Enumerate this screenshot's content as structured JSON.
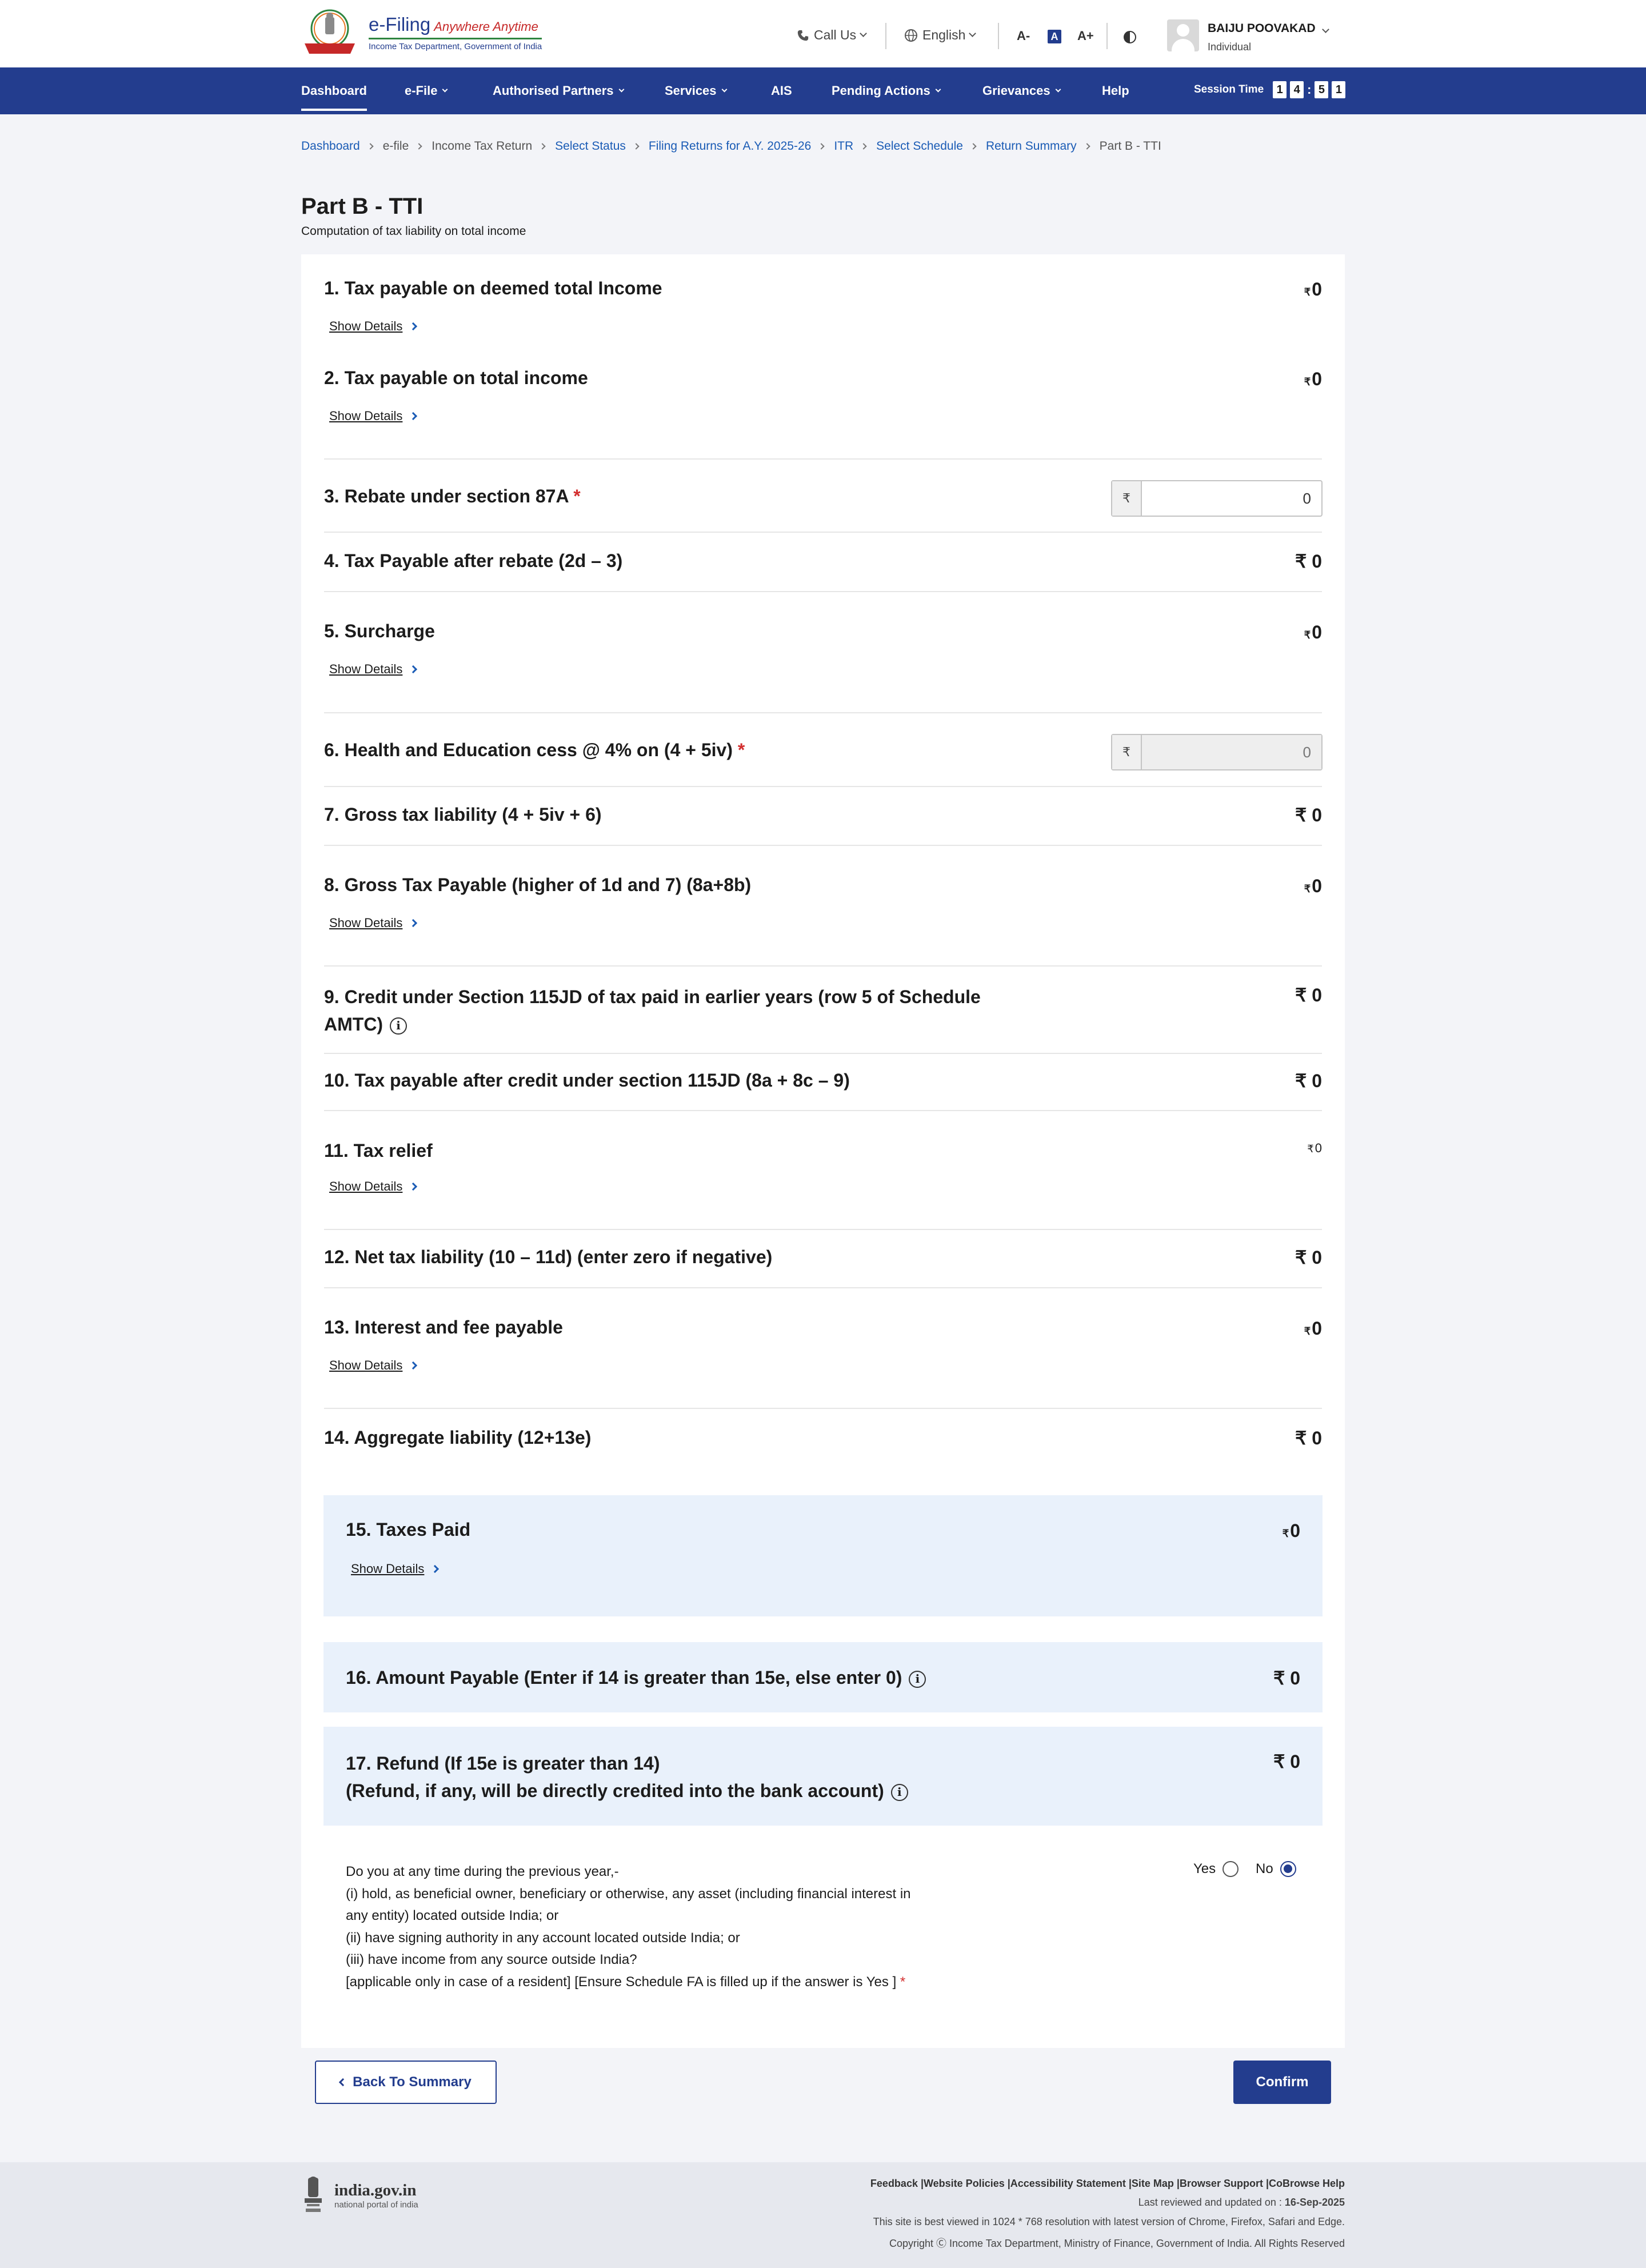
{
  "header": {
    "logo_title": "e-Filing",
    "logo_tagline": "Anywhere Anytime",
    "logo_subtitle": "Income Tax Department, Government of India",
    "call_us": "Call Us",
    "language": "English",
    "font_decrease": "A-",
    "font_normal": "A",
    "font_increase": "A+",
    "user_name": "BAIJU POOVAKAD",
    "user_role": "Individual"
  },
  "nav": {
    "items": [
      "Dashboard",
      "e-File",
      "Authorised Partners",
      "Services",
      "AIS",
      "Pending Actions",
      "Grievances",
      "Help"
    ],
    "session_label": "Session Time",
    "session_digits": [
      "1",
      "4",
      "5",
      "1"
    ]
  },
  "breadcrumb": [
    "Dashboard",
    "e-file",
    "Income Tax Return",
    "Select Status",
    "Filing Returns for A.Y. 2025-26",
    "ITR",
    "Select Schedule",
    "Return Summary",
    "Part B - TTI"
  ],
  "page": {
    "title": "Part B - TTI",
    "subtitle": "Computation of tax liability on total income"
  },
  "currency_symbol": "₹",
  "show_details_label": "Show Details",
  "rows": {
    "r1": {
      "label": "1. Tax payable on deemed total Income",
      "amount": "0"
    },
    "r2": {
      "label": "2. Tax payable on total income",
      "amount": "0"
    },
    "r3": {
      "label": "3. Rebate under section 87A",
      "required": "*",
      "value": "0"
    },
    "r4": {
      "label": "4. Tax Payable after rebate (2d – 3)",
      "amount": "0"
    },
    "r5": {
      "label": "5. Surcharge",
      "amount": "0"
    },
    "r6": {
      "label": "6. Health and Education cess @ 4% on (4 + 5iv)",
      "required": "*",
      "value": "0"
    },
    "r7": {
      "label": "7. Gross tax liability (4 + 5iv + 6)",
      "amount": "0"
    },
    "r8": {
      "label": "8. Gross Tax Payable (higher of 1d and 7) (8a+8b)",
      "amount": "0"
    },
    "r9": {
      "label_line1": "9. Credit under Section 115JD of tax paid in earlier years (row 5 of Schedule",
      "label_line2": "AMTC)",
      "amount": "0"
    },
    "r10": {
      "label": "10. Tax payable after credit under section 115JD (8a + 8c – 9)",
      "amount": "0"
    },
    "r11": {
      "label": "11. Tax relief",
      "amount": "0"
    },
    "r12": {
      "label": "12. Net tax liability (10 – 11d) (enter zero if negative)",
      "amount": "0"
    },
    "r13": {
      "label": "13. Interest and fee payable",
      "amount": "0"
    },
    "r14": {
      "label": "14. Aggregate liability (12+13e)",
      "amount": "0"
    },
    "r15": {
      "label": "15. Taxes Paid",
      "amount": "0"
    },
    "r16": {
      "label": "16. Amount Payable (Enter if 14 is greater than 15e, else enter 0)",
      "amount": "0"
    },
    "r17": {
      "label_line1": "17. Refund (If 15e is greater than 14)",
      "label_line2": "(Refund, if any, will be directly credited into the bank account)",
      "amount": "0"
    }
  },
  "foreign_asset_question": {
    "lines": [
      "Do you at any time during the previous year,-",
      "(i) hold, as beneficial owner, beneficiary or otherwise, any asset (including financial interest in",
      "any entity) located outside India; or",
      "(ii) have signing authority in any account located outside India; or",
      "(iii) have income from any source outside India?",
      "[applicable only in case of a resident] [Ensure Schedule FA is filled up if the answer is Yes ]"
    ],
    "required": "*",
    "yes_label": "Yes",
    "no_label": "No",
    "selected": "No"
  },
  "buttons": {
    "back": "Back To Summary",
    "confirm": "Confirm"
  },
  "footer": {
    "gov_name": "india.gov.in",
    "gov_tag": "national portal of india",
    "links": "Feedback |Website Policies |Accessibility Statement |Site Map |Browser Support |CoBrowse Help",
    "last_reviewed_label": "Last reviewed and updated on : ",
    "last_reviewed_date": "16-Sep-2025",
    "best_viewed": "This site is best viewed in 1024 * 768 resolution with latest version of Chrome, Firefox, Safari and Edge.",
    "copyright": "Copyright Ⓒ Income Tax Department, Ministry of Finance, Government of India. All Rights Reserved"
  },
  "colors": {
    "brand_blue": "#233d8e",
    "link_blue": "#1a5bb5",
    "highlight_bg": "#e9f1fb",
    "required_red": "#d32f2f"
  }
}
